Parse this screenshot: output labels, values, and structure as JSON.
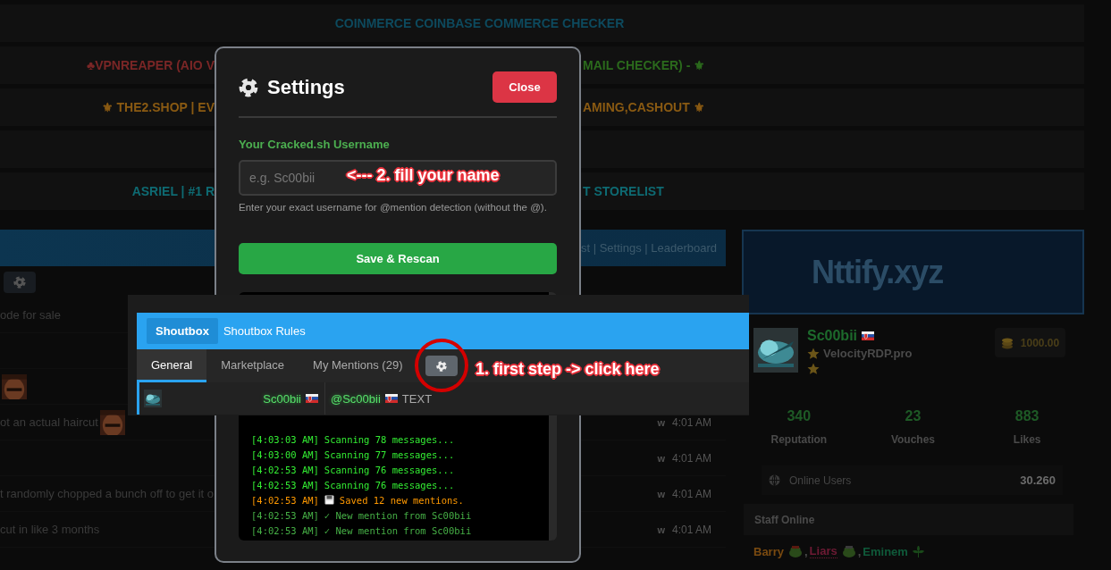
{
  "banners": [
    {
      "kind": "text",
      "center": {
        "text": "COINMERCE COINBASE COMMERCE CHECKER",
        "color": "#0d4a5e"
      }
    },
    {
      "kind": "text",
      "left": {
        "text": "♣VPNREAPER (AIO V",
        "color": "#7a2626"
      },
      "right": {
        "text": "MAIL CHECKER) - ⚜",
        "color": "#2b6a1c"
      }
    },
    {
      "kind": "text",
      "left": {
        "text": "⚜ THE2.SHOP | EV",
        "color": "#8a5a12"
      },
      "right": {
        "text": "AMING,CASHOUT ⚜",
        "color": "#8a5a12"
      }
    },
    {
      "kind": "empty"
    },
    {
      "kind": "text",
      "left": {
        "text": "ASRIEL | #1 R",
        "color": "#0e6a72"
      },
      "right": {
        "text": "T STORELIST",
        "color": "#0e6a72"
      }
    }
  ],
  "forum": {
    "header_links": "st | Settings | Leaderboard",
    "messages": [
      {
        "kind": "message",
        "text": "ode for sale"
      },
      {
        "kind": "blank"
      },
      {
        "kind": "message",
        "emote": true
      },
      {
        "kind": "message",
        "text": "ot an actual haircut",
        "emote": true,
        "role": "w",
        "time": "4:01 AM"
      },
      {
        "kind": "message",
        "role": "w",
        "time": "4:01 AM"
      },
      {
        "kind": "message",
        "text": "t randomly chopped a bunch off to get it o",
        "role": "w",
        "time": "4:01 AM"
      },
      {
        "kind": "message",
        "text": "cut in like 3 months",
        "role": "w",
        "time": "4:01 AM"
      }
    ]
  },
  "sidebar": {
    "ad": "Nttify.xyz",
    "profile": {
      "name": "Sc00bii",
      "title": "VelocityRDP.pro",
      "credits": "1000.00"
    },
    "stats": [
      {
        "value": "340",
        "label": "Reputation"
      },
      {
        "value": "23",
        "label": "Vouches"
      },
      {
        "value": "883",
        "label": "Likes"
      }
    ],
    "online": {
      "label": "Online Users",
      "value": "30.260"
    },
    "staff_header": "Staff Online",
    "staff": [
      {
        "name": "Barry",
        "color": "#7a4a10",
        "separator": ","
      },
      {
        "name": "Liars",
        "color": "#6e1a34",
        "separator": ","
      },
      {
        "name": "Eminem",
        "color": "#0f5a3a"
      }
    ]
  },
  "settings_dialog": {
    "title": "Settings",
    "close": "Close",
    "label": "Your Cracked.sh Username",
    "placeholder": "e.g. Sc00bii",
    "help": "Enter your exact username for @mention detection (without the @).",
    "save": "Save & Rescan",
    "log": [
      {
        "kind": "scan",
        "time": "[4:03:03 AM]",
        "text": "Scanning 78 messages..."
      },
      {
        "kind": "scan",
        "time": "[4:03:00 AM]",
        "text": "Scanning 77 messages..."
      },
      {
        "kind": "scan",
        "time": "[4:02:53 AM]",
        "text": "Scanning 76 messages..."
      },
      {
        "kind": "scan",
        "time": "[4:02:53 AM]",
        "text": "Scanning 76 messages..."
      },
      {
        "kind": "saved",
        "time": "[4:02:53 AM]",
        "text": "Saved 12 new mentions."
      },
      {
        "kind": "mention",
        "time": "[4:02:53 AM]",
        "text": "✓ New mention from Sc00bii"
      },
      {
        "kind": "mention",
        "time": "[4:02:53 AM]",
        "text": "✓ New mention from Sc00bii"
      }
    ]
  },
  "shoutbox": {
    "title": "Shoutbox",
    "rules": "Shoutbox Rules",
    "tabs": [
      {
        "label": "General",
        "selected": true
      },
      {
        "label": "Marketplace",
        "selected": false
      },
      {
        "label": "My Mentions (29)",
        "selected": false
      }
    ],
    "message": {
      "author": "Sc00bii",
      "mention": "@Sc00bii",
      "text": "TEXT"
    }
  },
  "annotations": [
    {
      "text": "1. first step -> click here"
    },
    {
      "text": "<--- 2. fill your name"
    }
  ]
}
